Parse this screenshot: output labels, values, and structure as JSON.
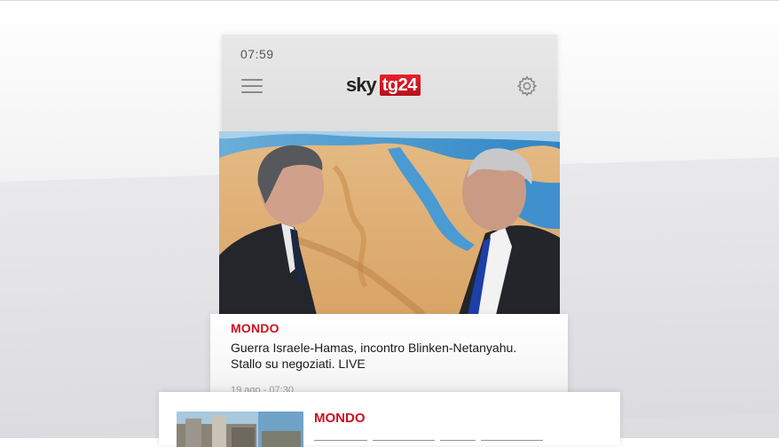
{
  "status_bar": {
    "time": "07:59"
  },
  "header": {
    "logo_sky": "sky",
    "logo_tg": "tg24",
    "menu_icon": "hamburger-menu-icon",
    "settings_icon": "gear-icon"
  },
  "colors": {
    "brand_red": "#cc1120",
    "logo_red": "#e8202b",
    "header_bg": "#e3e3e3"
  },
  "articles": [
    {
      "category": "MONDO",
      "title": "Guerra Israele-Hamas, incontro Blinken-Netanyahu. Stallo su negoziati. LIVE",
      "date": "19 ago - 07:30"
    },
    {
      "category": "MONDO"
    }
  ]
}
